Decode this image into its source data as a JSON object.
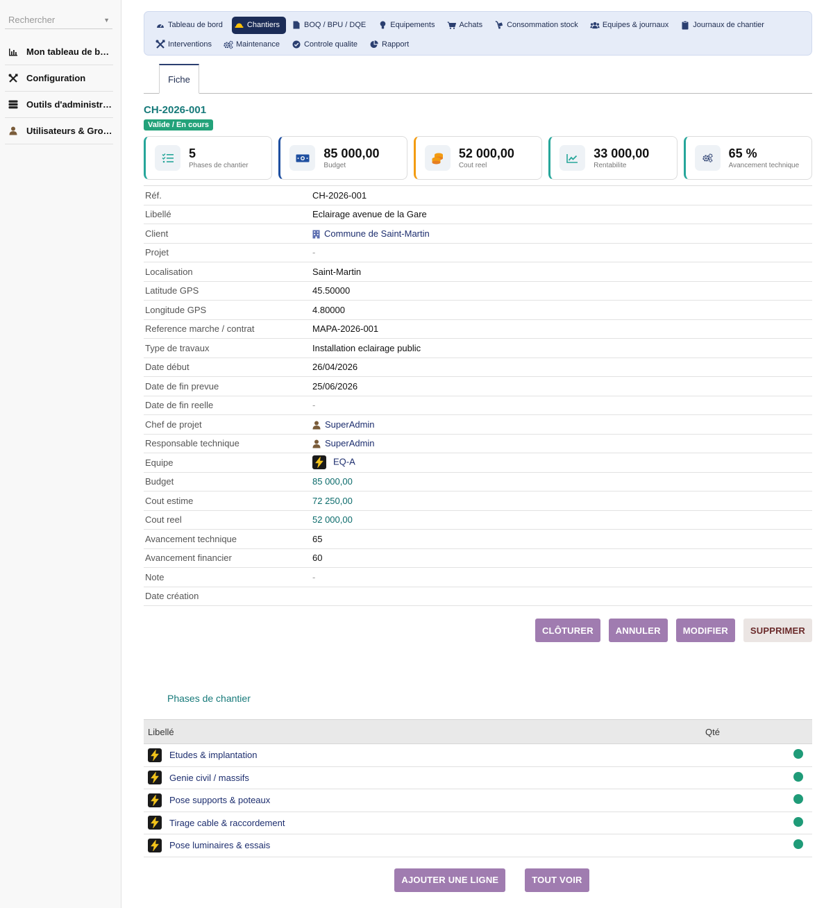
{
  "sidebar": {
    "search_placeholder": "Rechercher",
    "items": [
      {
        "label": "Mon tableau de bord",
        "icon": "bar-chart-icon"
      },
      {
        "label": "Configuration",
        "icon": "tools-icon"
      },
      {
        "label": "Outils d'administrat...",
        "icon": "server-icon"
      },
      {
        "label": "Utilisateurs & Grou...",
        "icon": "user-icon"
      }
    ]
  },
  "topnav": {
    "row1": [
      {
        "label": "Tableau de bord",
        "icon": "gauge-icon"
      },
      {
        "label": "Chantiers",
        "icon": "hardhat-icon",
        "active": true
      },
      {
        "label": "BOQ / BPU / DQE",
        "icon": "file-icon"
      },
      {
        "label": "Equipements",
        "icon": "bulb-icon"
      },
      {
        "label": "Achats",
        "icon": "cart-icon"
      },
      {
        "label": "Consommation stock",
        "icon": "dolly-icon"
      },
      {
        "label": "Equipes & journaux",
        "icon": "users-icon"
      },
      {
        "label": "Journaux de chantier",
        "icon": "clipboard-icon"
      }
    ],
    "row2": [
      {
        "label": "Interventions",
        "icon": "tools-icon"
      },
      {
        "label": "Maintenance",
        "icon": "cogs-icon"
      },
      {
        "label": "Controle qualite",
        "icon": "check-circle-icon"
      },
      {
        "label": "Rapport",
        "icon": "pie-chart-icon"
      }
    ]
  },
  "tab": {
    "label": "Fiche"
  },
  "record": {
    "ref": "CH-2026-001",
    "status": "Valide / En cours"
  },
  "cards": [
    {
      "value": "5",
      "label": "Phases de chantier",
      "accent": "#26a69a",
      "icon": "checklist-icon"
    },
    {
      "value": "85 000,00",
      "label": "Budget",
      "accent": "#1e4fa0",
      "icon": "money-icon"
    },
    {
      "value": "52 000,00",
      "label": "Cout reel",
      "accent": "#f39c12",
      "icon": "coins-icon"
    },
    {
      "value": "33 000,00",
      "label": "Rentabilite",
      "accent": "#26a69a",
      "icon": "trend-icon"
    },
    {
      "value": "65 %",
      "label": "Avancement technique",
      "accent": "#26a69a",
      "icon": "cogs-icon"
    }
  ],
  "fields": [
    {
      "key": "Réf.",
      "value": "CH-2026-001"
    },
    {
      "key": "Libellé",
      "value": "Eclairage avenue de la Gare"
    },
    {
      "key": "Client",
      "value": "Commune de Saint-Martin",
      "type": "link",
      "icon": "building-icon"
    },
    {
      "key": "Projet",
      "value": "-",
      "type": "dash"
    },
    {
      "key": "Localisation",
      "value": "Saint-Martin"
    },
    {
      "key": "Latitude GPS",
      "value": "45.50000"
    },
    {
      "key": "Longitude GPS",
      "value": "4.80000"
    },
    {
      "key": "Reference marche / contrat",
      "value": "MAPA-2026-001"
    },
    {
      "key": "Type de travaux",
      "value": "Installation eclairage public"
    },
    {
      "key": "Date début",
      "value": "26/04/2026"
    },
    {
      "key": "Date de fin prevue",
      "value": "25/06/2026"
    },
    {
      "key": "Date de fin reelle",
      "value": "-",
      "type": "dash"
    },
    {
      "key": "Chef de projet",
      "value": "SuperAdmin",
      "type": "link",
      "icon": "user-icon"
    },
    {
      "key": "Responsable technique",
      "value": "SuperAdmin",
      "type": "link",
      "icon": "user-icon"
    },
    {
      "key": "Equipe",
      "value": "EQ-A",
      "type": "link",
      "icon": "bolt-icon"
    },
    {
      "key": "Budget",
      "value": "85 000,00",
      "type": "money"
    },
    {
      "key": "Cout estime",
      "value": "72 250,00",
      "type": "money"
    },
    {
      "key": "Cout reel",
      "value": "52 000,00",
      "type": "money"
    },
    {
      "key": "Avancement technique",
      "value": "65"
    },
    {
      "key": "Avancement financier",
      "value": "60"
    },
    {
      "key": "Note",
      "value": "-",
      "type": "dash"
    },
    {
      "key": "Date création",
      "value": ""
    }
  ],
  "actions": [
    {
      "label": "CLÔTURER",
      "name": "cloturer-button"
    },
    {
      "label": "ANNULER",
      "name": "annuler-button"
    },
    {
      "label": "MODIFIER",
      "name": "modifier-button"
    },
    {
      "label": "SUPPRIMER",
      "name": "supprimer-button",
      "light": true
    }
  ],
  "phases": {
    "title": "Phases de chantier",
    "col_label": "Libellé",
    "col_qty": "Qté",
    "rows": [
      {
        "label": "Etudes & implantation",
        "status_color": "#1f9b78"
      },
      {
        "label": "Genie civil / massifs",
        "status_color": "#1f9b78"
      },
      {
        "label": "Pose supports & poteaux",
        "status_color": "#1f9b78"
      },
      {
        "label": "Tirage cable & raccordement",
        "status_color": "#1f9b78"
      },
      {
        "label": "Pose luminaires & essais",
        "status_color": "#1f9b78"
      }
    ]
  },
  "bottom_actions": [
    {
      "label": "AJOUTER UNE LIGNE",
      "name": "add-line-button"
    },
    {
      "label": "TOUT VOIR",
      "name": "view-all-button"
    }
  ]
}
